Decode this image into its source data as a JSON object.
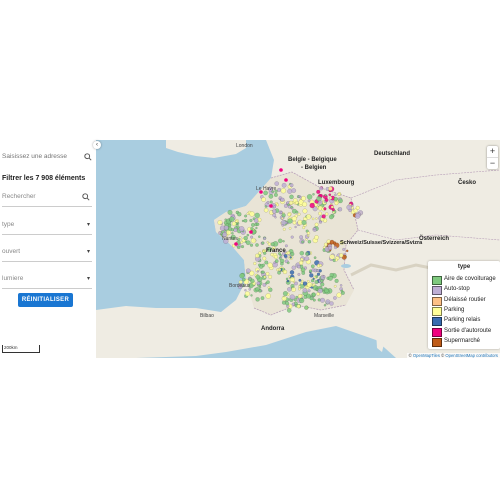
{
  "sidebar": {
    "search_placeholder": "Saisissez une adresse",
    "title": "Filtrer les 7 908 éléments",
    "search_field_label": "Rechercher",
    "filters": [
      {
        "label": "type",
        "icon": "chevron-down-icon"
      },
      {
        "label": "ouvert",
        "icon": "chevron-down-icon"
      },
      {
        "label": "lumiere",
        "icon": "chevron-down-icon"
      }
    ],
    "reset_label": "RÉINITIALISER",
    "scale_label": "200km",
    "collapse_icon": "‹"
  },
  "map": {
    "labels": {
      "uk_city": "London",
      "belgique": "Belgïe - Belgique",
      "belgium_de": "- Belgien",
      "deutschland": "Deutschland",
      "luxembourg": "Luxembourg",
      "cesko": "Česko",
      "osterreich": "Österreich",
      "schweiz": "Schweiz/Suisse/Svizzera/Svizra",
      "france": "France",
      "andorra": "Andorra",
      "bordeaux": "Bordeaux",
      "marseille": "Marseille",
      "bilbao": "Bilbao",
      "le_havre": "Le Havre",
      "nantes": "Nantes"
    },
    "zoom_in": "+",
    "zoom_out": "−",
    "attribution_prefix": "© ",
    "attribution_tiles": "OpenMapTiles",
    "attribution_mid": " © ",
    "attribution_osm": "OpenStreetMap contributors"
  },
  "legend": {
    "title": "type",
    "items": [
      {
        "label": "Aire de covoiturage",
        "color": "#7fc97f"
      },
      {
        "label": "Auto-stop",
        "color": "#beaed4"
      },
      {
        "label": "Délaissé routier",
        "color": "#fdc086"
      },
      {
        "label": "Parking",
        "color": "#ffff99"
      },
      {
        "label": "Parking relais",
        "color": "#386cb0"
      },
      {
        "label": "Sortie d'autoroute",
        "color": "#f0027f"
      },
      {
        "label": "Supermarché",
        "color": "#bf5b17"
      }
    ]
  }
}
